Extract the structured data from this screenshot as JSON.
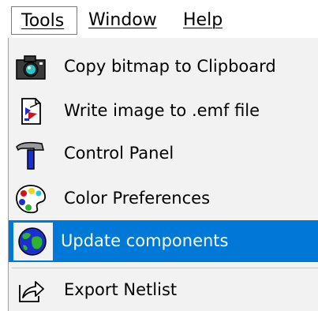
{
  "menubar": {
    "items": [
      {
        "label": "Tools",
        "active": true
      },
      {
        "label": "Window"
      },
      {
        "label": "Help"
      }
    ]
  },
  "menu": {
    "items": [
      {
        "label": "Copy bitmap to Clipboard",
        "icon": "camera-icon"
      },
      {
        "label": "Write image to .emf file",
        "icon": "image-file-icon"
      },
      {
        "label": "Control Panel",
        "icon": "hammer-icon"
      },
      {
        "label": "Color Preferences",
        "icon": "palette-icon"
      },
      {
        "label": "Update components",
        "icon": "globe-icon",
        "highlighted": true
      },
      {
        "label": "Export Netlist",
        "icon": "export-icon"
      }
    ]
  },
  "colors": {
    "highlight": "#0078d7",
    "menu_background": "#f2f2f2"
  }
}
